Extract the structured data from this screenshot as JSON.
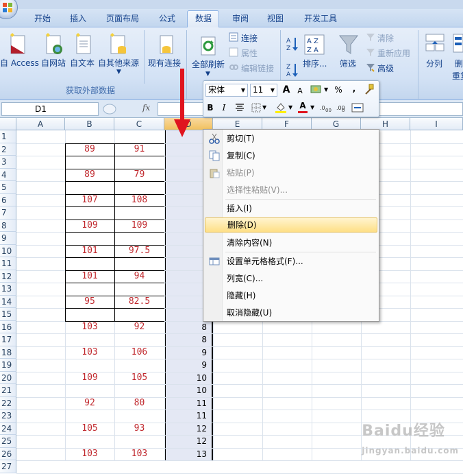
{
  "ribbon": {
    "tabs": [
      {
        "label": "开始"
      },
      {
        "label": "插入"
      },
      {
        "label": "页面布局"
      },
      {
        "label": "公式"
      },
      {
        "label": "数据"
      },
      {
        "label": "审阅"
      },
      {
        "label": "视图"
      },
      {
        "label": "开发工具"
      }
    ],
    "active_tab": "数据",
    "get_external_data": {
      "from_access": "自 Access",
      "from_web": "自网站",
      "from_text": "自文本",
      "from_other": "自其他来源",
      "existing_connections": "现有连接",
      "group_label": "获取外部数据"
    },
    "connections": {
      "refresh_all": "全部刷新",
      "connections": "连接",
      "properties": "属性",
      "edit_links": "编辑链接"
    },
    "sort_filter": {
      "sort": "排序...",
      "filter": "筛选",
      "clear": "清除",
      "reapply": "重新应用",
      "advanced": "高级"
    },
    "data_tools": {
      "text_to_columns": "分列",
      "remove_duplicates": "删除",
      "remove_duplicates_2": "重复"
    }
  },
  "formula_bar": {
    "name_box": "D1",
    "fx": "fx"
  },
  "sheet": {
    "columns": [
      "A",
      "B",
      "C",
      "D",
      "E",
      "F",
      "G",
      "H",
      "I"
    ],
    "rows": [
      "1",
      "2",
      "3",
      "4",
      "5",
      "6",
      "7",
      "8",
      "9",
      "10",
      "11",
      "12",
      "13",
      "14",
      "15",
      "16",
      "17",
      "18",
      "19",
      "20",
      "21",
      "22",
      "23",
      "24",
      "25"
    ],
    "col_b": {
      "2": "89",
      "4": "89",
      "6": "107",
      "8": "109",
      "10": "101",
      "12": "101",
      "14": "95",
      "16": "103",
      "18": "103",
      "20": "109",
      "22": "92",
      "24": "105",
      "26": "103"
    },
    "col_c": {
      "2": "91",
      "4": "79",
      "6": "108",
      "8": "109",
      "10": "97.5",
      "12": "94",
      "14": "82.5",
      "16": "92",
      "18": "106",
      "20": "105",
      "22": "80",
      "24": "93",
      "26": "103"
    },
    "col_d": {
      "16": "8",
      "17": "8",
      "18": "9",
      "19": "9",
      "20": "10",
      "21": "10",
      "22": "11",
      "23": "11",
      "24": "12",
      "25": "12",
      "26": "13"
    }
  },
  "mini_toolbar": {
    "font": "宋体",
    "size": "11",
    "grow": "A",
    "shrink": "A",
    "percent": "%",
    "comma": ",",
    "bold": "B",
    "italic": "I",
    "font_color": "A"
  },
  "context_menu": {
    "cut": "剪切(T)",
    "copy": "复制(C)",
    "paste": "粘贴(P)",
    "paste_special": "选择性粘贴(V)...",
    "insert": "插入(I)",
    "delete": "删除(D)",
    "clear_contents": "清除内容(N)",
    "format_cells": "设置单元格格式(F)...",
    "column_width": "列宽(C)...",
    "hide": "隐藏(H)",
    "unhide": "取消隐藏(U)"
  },
  "watermark": {
    "text": "Baidu经验",
    "sub": "jingyan.baidu.com"
  },
  "colors": {
    "ribbon_blue": "#d3e2f5",
    "value_red": "#c0282d",
    "arrow_red": "#e0141e",
    "highlight": "#fedf86"
  }
}
